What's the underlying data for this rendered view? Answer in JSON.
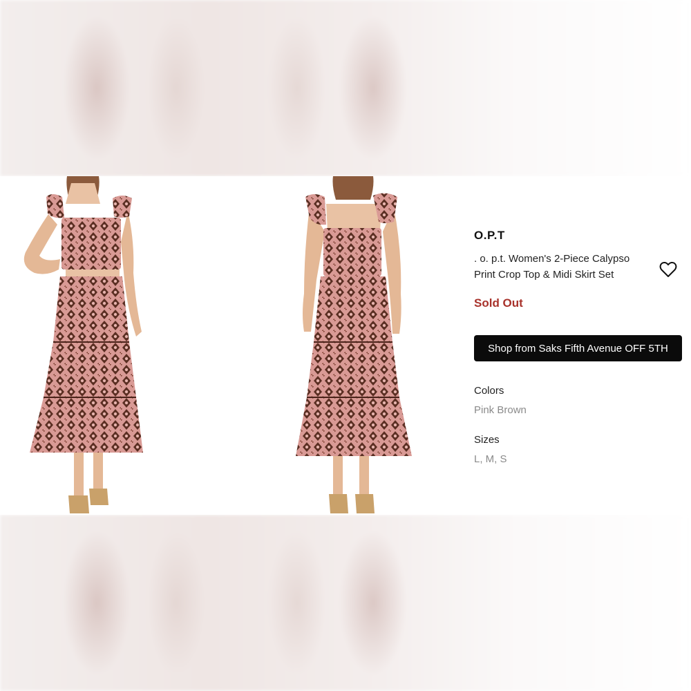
{
  "product": {
    "brand": "O.P.T",
    "title": ". o. p.t. Women's 2-Piece Calypso Print Crop Top & Midi Skirt Set",
    "status": "Sold Out",
    "shop_button_label": "Shop from Saks Fifth Avenue OFF 5TH",
    "colors_label": "Colors",
    "colors_value": "Pink Brown",
    "sizes_label": "Sizes",
    "sizes_value": "L, M, S"
  },
  "icons": {
    "favorite": "heart-outline-icon"
  },
  "colors": {
    "status_red": "#a8322b",
    "button_bg": "#0b0b0b",
    "secondary_text": "#8a8a8a",
    "dress_pink": "#d99a95",
    "dress_brown": "#5a2e22"
  }
}
